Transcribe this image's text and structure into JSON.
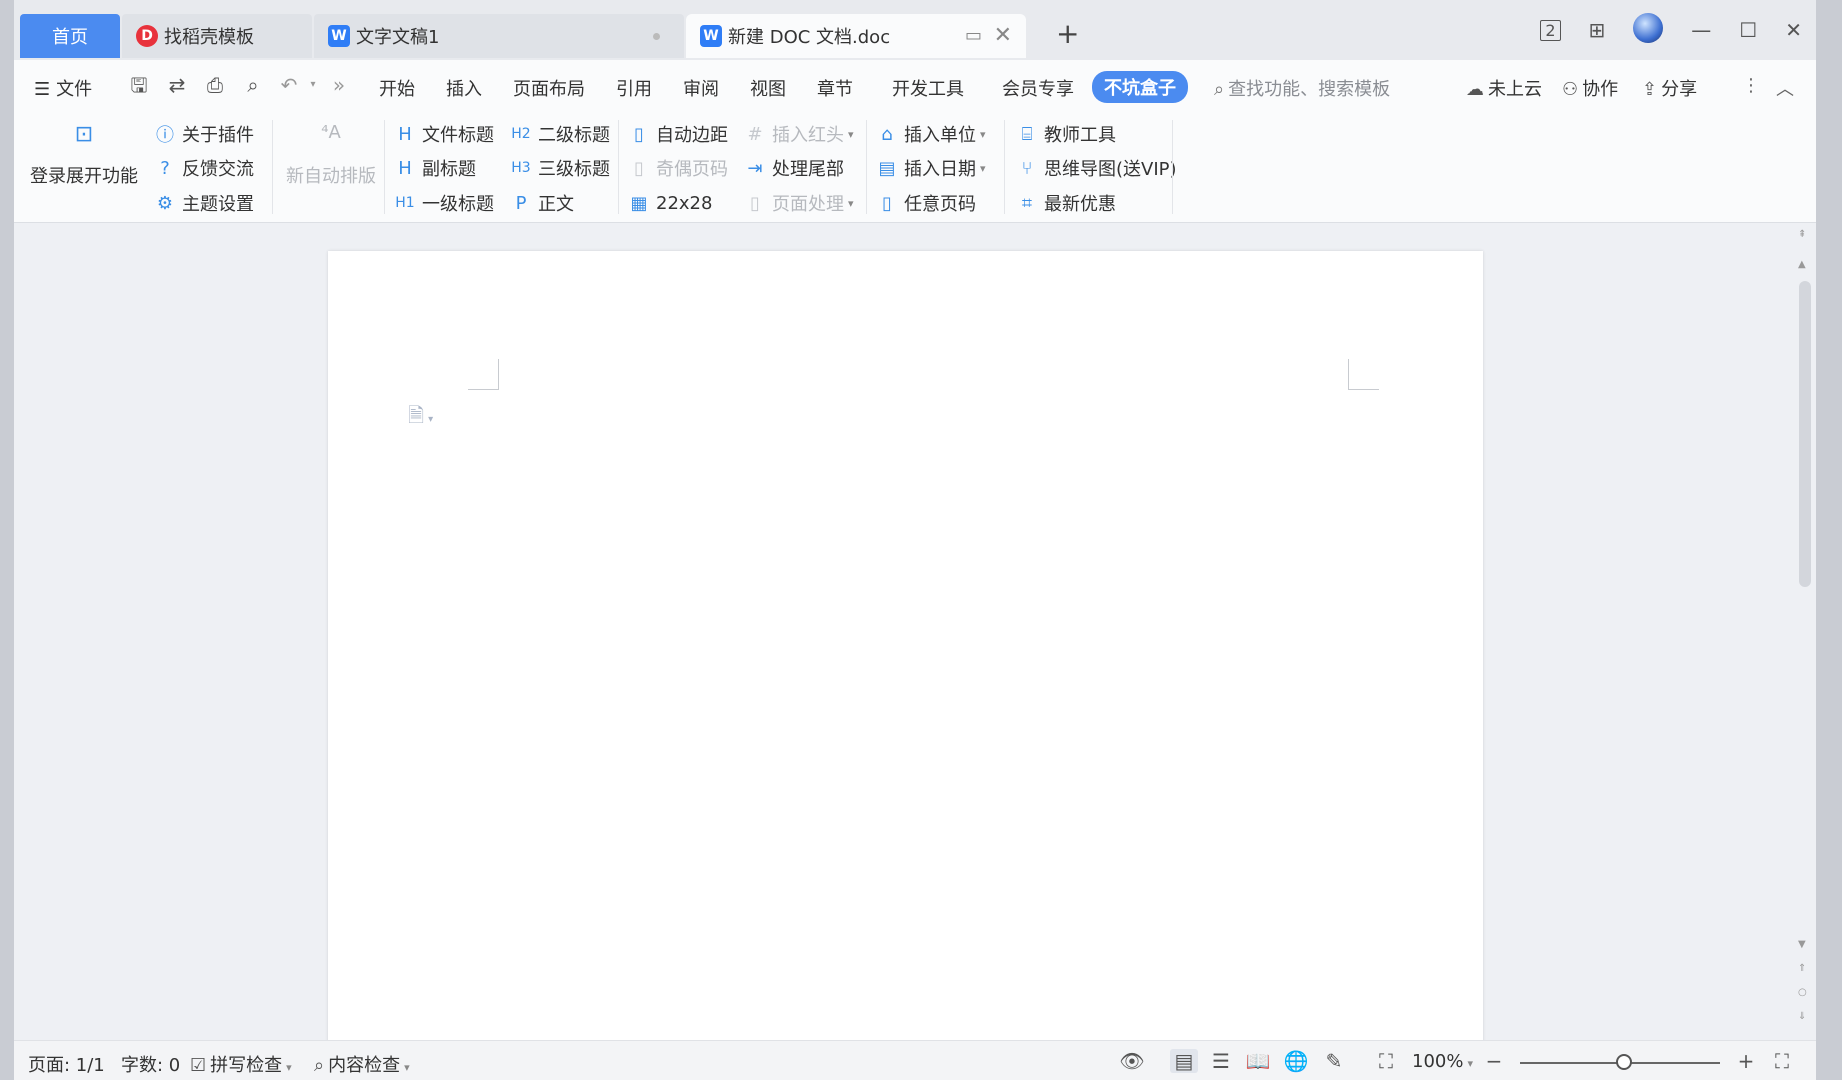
{
  "tabs": {
    "home": "首页",
    "docer": "找稻壳模板",
    "doc1": "文字文稿1",
    "active": "新建 DOC 文档.doc"
  },
  "menu": {
    "file": "文件",
    "items": [
      "开始",
      "插入",
      "页面布局",
      "引用",
      "审阅",
      "视图",
      "章节",
      "开发工具",
      "会员专享"
    ],
    "highlight": "不坑盒子",
    "search_placeholder": "查找功能、搜索模板",
    "cloud": "未上云",
    "collab": "协作",
    "share": "分享"
  },
  "ribbon": {
    "login": "登录展开功能",
    "about": "关于插件",
    "feedback": "反馈交流",
    "theme": "主题设置",
    "autolayout": "新自动排版",
    "file_title": "文件标题",
    "subtitle": "副标题",
    "h1": "一级标题",
    "h2": "二级标题",
    "h3": "三级标题",
    "body": "正文",
    "auto_margin": "自动边距",
    "odd_even": "奇偶页码",
    "grid": "22x28",
    "insert_redhead": "插入红头",
    "process_tail": "处理尾部",
    "page_process": "页面处理",
    "insert_unit": "插入单位",
    "insert_date": "插入日期",
    "any_page": "任意页码",
    "teacher_tools": "教师工具",
    "mindmap": "思维导图(送VIP)",
    "latest_offer": "最新优惠"
  },
  "status": {
    "page": "页面: 1/1",
    "words": "字数: 0",
    "spell": "拼写检查",
    "content_check": "内容检查",
    "zoom": "100%"
  },
  "colors": {
    "accent": "#4b8bf0",
    "ribbon_icon": "#3a8ee6",
    "disabled": "#b6b9be"
  }
}
